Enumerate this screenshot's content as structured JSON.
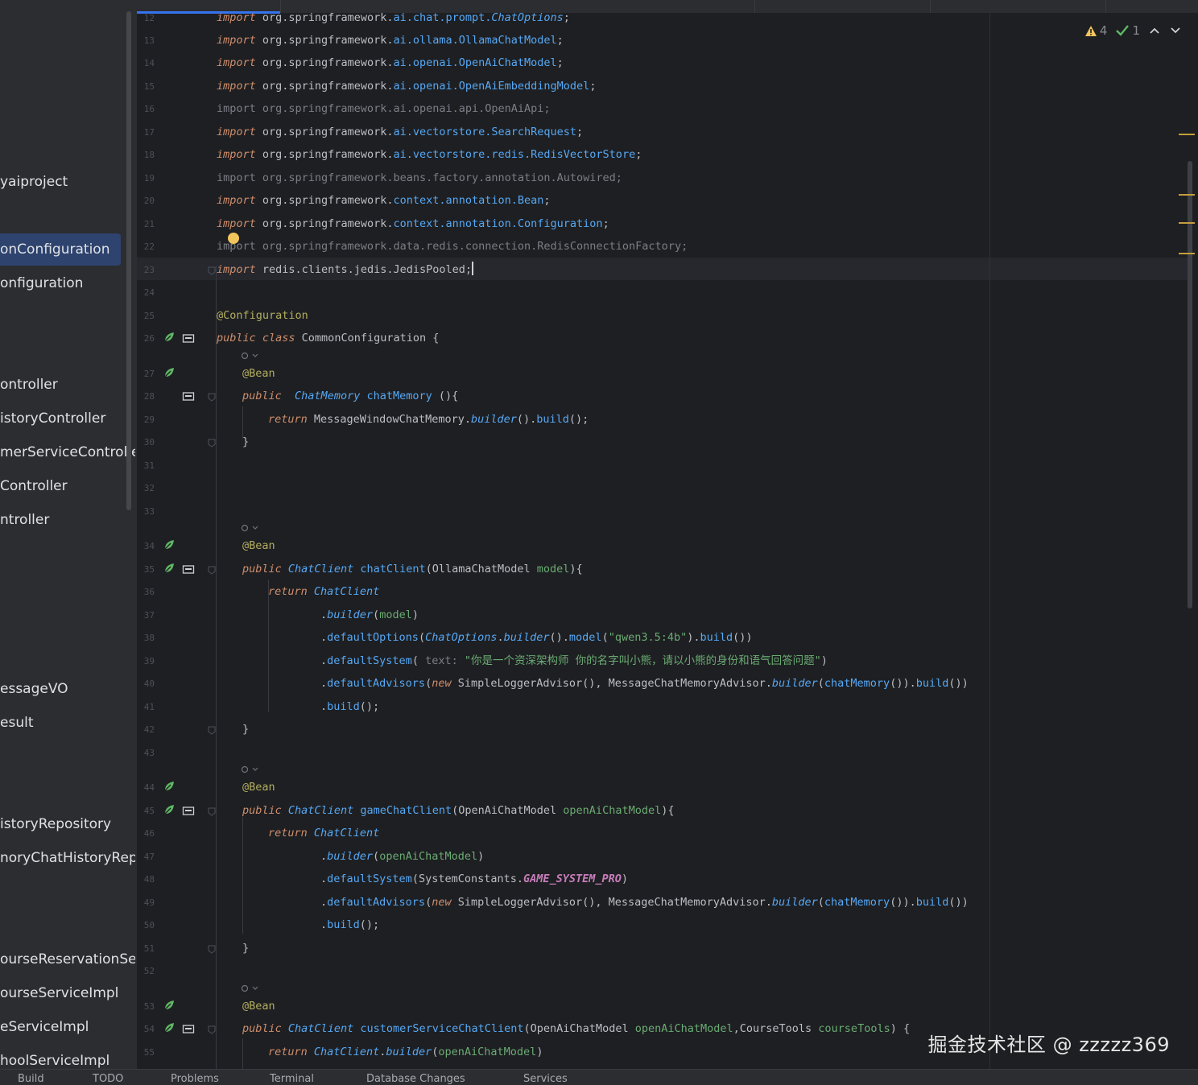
{
  "project_tree": {
    "items": [
      {
        "label": "yaiproject",
        "selected": false
      },
      {
        "label": "onConfiguration",
        "selected": true
      },
      {
        "label": "onfiguration",
        "selected": false
      },
      {
        "label": "ontroller",
        "selected": false
      },
      {
        "label": "istoryController",
        "selected": false
      },
      {
        "label": "merServiceController",
        "selected": false
      },
      {
        "label": "Controller",
        "selected": false
      },
      {
        "label": "ntroller",
        "selected": false
      },
      {
        "label": "essageVO",
        "selected": false
      },
      {
        "label": "esult",
        "selected": false
      },
      {
        "label": "istoryRepository",
        "selected": false
      },
      {
        "label": "noryChatHistoryRepos",
        "selected": false
      },
      {
        "label": "ourseReservationServ",
        "selected": false
      },
      {
        "label": "ourseServiceImpl",
        "selected": false
      },
      {
        "label": "eServiceImpl",
        "selected": false
      },
      {
        "label": "hoolServiceImpl",
        "selected": false
      }
    ]
  },
  "inspection": {
    "warnings": "4",
    "ok": "1"
  },
  "editor": {
    "line_numbers": [
      "12",
      "13",
      "14",
      "15",
      "16",
      "17",
      "18",
      "19",
      "20",
      "21",
      "22",
      "23",
      "24",
      "25",
      "26",
      "27",
      "28",
      "29",
      "30",
      "31",
      "32",
      "33",
      "34",
      "35",
      "36",
      "37",
      "38",
      "39",
      "40",
      "41",
      "42",
      "43",
      "44",
      "45",
      "46",
      "47",
      "48",
      "49",
      "50",
      "51",
      "52",
      "53",
      "54",
      "55"
    ],
    "lines": [
      {
        "ln": "12",
        "tokens": [
          [
            "kw",
            "import"
          ],
          [
            "cls",
            " org.springframework."
          ],
          [
            "fn",
            "ai.chat.prompt."
          ],
          [
            "iv",
            "ChatOptions"
          ],
          [
            "cls",
            ";"
          ]
        ]
      },
      {
        "ln": "13",
        "tokens": [
          [
            "kw",
            "import"
          ],
          [
            "cls",
            " org.springframework."
          ],
          [
            "fn",
            "ai.ollama.OllamaChatModel"
          ],
          [
            "cls",
            ";"
          ]
        ]
      },
      {
        "ln": "14",
        "tokens": [
          [
            "kw",
            "import"
          ],
          [
            "cls",
            " org.springframework."
          ],
          [
            "fn",
            "ai.openai.OpenAiChatModel"
          ],
          [
            "cls",
            ";"
          ]
        ]
      },
      {
        "ln": "15",
        "tokens": [
          [
            "kw",
            "import"
          ],
          [
            "cls",
            " org.springframework."
          ],
          [
            "fn",
            "ai.openai.OpenAiEmbeddingModel"
          ],
          [
            "cls",
            ";"
          ]
        ]
      },
      {
        "ln": "16",
        "tokens": [
          [
            "dim",
            "import org.springframework.ai.openai.api.OpenAiApi;"
          ]
        ]
      },
      {
        "ln": "17",
        "tokens": [
          [
            "kw",
            "import"
          ],
          [
            "cls",
            " org.springframework."
          ],
          [
            "fn",
            "ai.vectorstore.SearchRequest"
          ],
          [
            "cls",
            ";"
          ]
        ]
      },
      {
        "ln": "18",
        "tokens": [
          [
            "kw",
            "import"
          ],
          [
            "cls",
            " org.springframework."
          ],
          [
            "fn",
            "ai.vectorstore.redis.RedisVectorStore"
          ],
          [
            "cls",
            ";"
          ]
        ]
      },
      {
        "ln": "19",
        "tokens": [
          [
            "dim",
            "import org.springframework.beans.factory.annotation.Autowired;"
          ]
        ]
      },
      {
        "ln": "20",
        "tokens": [
          [
            "kw",
            "import"
          ],
          [
            "cls",
            " org.springframework."
          ],
          [
            "fn",
            "context.annotation.Bean"
          ],
          [
            "cls",
            ";"
          ]
        ]
      },
      {
        "ln": "21",
        "tokens": [
          [
            "kw",
            "import"
          ],
          [
            "cls",
            " org.springframework."
          ],
          [
            "fn",
            "context.annotation.Configuration"
          ],
          [
            "cls",
            ";"
          ]
        ]
      },
      {
        "ln": "22",
        "tokens": [
          [
            "dim",
            "import org.springframework.data.redis.connection.RedisConnectionFactory;"
          ]
        ]
      },
      {
        "ln": "23",
        "tokens": [
          [
            "kw",
            "import"
          ],
          [
            "cls",
            " redis.clients.jedis.JedisPooled;"
          ]
        ]
      },
      {
        "ln": "24",
        "tokens": []
      },
      {
        "ln": "25",
        "tokens": [
          [
            "ann",
            "@Configuration"
          ]
        ]
      },
      {
        "ln": "26",
        "tokens": [
          [
            "kw",
            "public class"
          ],
          [
            "cls",
            " CommonConfiguration {"
          ]
        ]
      },
      {
        "ln": "27",
        "tokens": [
          [
            "ann",
            "@Bean"
          ]
        ]
      },
      {
        "ln": "28",
        "tokens": [
          [
            "kw",
            "public"
          ],
          [
            "cls",
            "  "
          ],
          [
            "iv",
            "ChatMemory"
          ],
          [
            "fn",
            " chatMemory"
          ],
          [
            "cls",
            " (){"
          ]
        ]
      },
      {
        "ln": "29",
        "tokens": [
          [
            "kw",
            "return"
          ],
          [
            "cls",
            " MessageWindowChatMemory."
          ],
          [
            "iv",
            "builder"
          ],
          [
            "cls",
            "()."
          ],
          [
            "fn",
            "build"
          ],
          [
            "cls",
            "();"
          ]
        ]
      },
      {
        "ln": "30",
        "tokens": [
          [
            "cls",
            "}"
          ]
        ]
      },
      {
        "ln": "31",
        "tokens": []
      },
      {
        "ln": "32",
        "tokens": []
      },
      {
        "ln": "33",
        "tokens": []
      },
      {
        "ln": "34",
        "tokens": [
          [
            "ann",
            "@Bean"
          ]
        ]
      },
      {
        "ln": "35",
        "tokens": [
          [
            "kw",
            "public"
          ],
          [
            "cls",
            " "
          ],
          [
            "iv",
            "ChatClient"
          ],
          [
            "fn",
            " chatClient"
          ],
          [
            "cls",
            "(OllamaChatModel "
          ],
          [
            "st",
            "model"
          ],
          [
            "cls",
            "){"
          ]
        ]
      },
      {
        "ln": "36",
        "tokens": [
          [
            "kw",
            "return"
          ],
          [
            "cls",
            " "
          ],
          [
            "iv",
            "ChatClient"
          ]
        ]
      },
      {
        "ln": "37",
        "tokens": [
          [
            "cls",
            "."
          ],
          [
            "iv",
            "builder"
          ],
          [
            "cls",
            "("
          ],
          [
            "st",
            "model"
          ],
          [
            "cls",
            ")"
          ]
        ]
      },
      {
        "ln": "38",
        "tokens": [
          [
            "cls",
            "."
          ],
          [
            "fn",
            "defaultOptions"
          ],
          [
            "cls",
            "("
          ],
          [
            "iv",
            "ChatOptions"
          ],
          [
            "cls",
            "."
          ],
          [
            "iv",
            "builder"
          ],
          [
            "cls",
            "()."
          ],
          [
            "fn",
            "model"
          ],
          [
            "cls",
            "("
          ],
          [
            "st",
            "\"qwen3.5:4b\""
          ],
          [
            "cls",
            ")."
          ],
          [
            "fn",
            "build"
          ],
          [
            "cls",
            "())"
          ]
        ]
      },
      {
        "ln": "39",
        "tokens": [
          [
            "cls",
            "."
          ],
          [
            "fn",
            "defaultSystem"
          ],
          [
            "cls",
            "( "
          ],
          [
            "dim",
            "text:"
          ],
          [
            "st",
            " \"你是一个资深架构师 你的名字叫小熊，请以小熊的身份和语气回答问题\""
          ],
          [
            "cls",
            ")"
          ]
        ]
      },
      {
        "ln": "40",
        "tokens": [
          [
            "cls",
            "."
          ],
          [
            "fn",
            "defaultAdvisors"
          ],
          [
            "cls",
            "("
          ],
          [
            "kw",
            "new"
          ],
          [
            "cls",
            " SimpleLoggerAdvisor(), MessageChatMemoryAdvisor."
          ],
          [
            "iv",
            "builder"
          ],
          [
            "cls",
            "("
          ],
          [
            "fn",
            "chatMemory"
          ],
          [
            "cls",
            "())."
          ],
          [
            "fn",
            "build"
          ],
          [
            "cls",
            "())"
          ]
        ]
      },
      {
        "ln": "41",
        "tokens": [
          [
            "cls",
            "."
          ],
          [
            "fn",
            "build"
          ],
          [
            "cls",
            "();"
          ]
        ]
      },
      {
        "ln": "42",
        "tokens": [
          [
            "cls",
            "}"
          ]
        ]
      },
      {
        "ln": "43",
        "tokens": []
      },
      {
        "ln": "44",
        "tokens": [
          [
            "ann",
            "@Bean"
          ]
        ]
      },
      {
        "ln": "45",
        "tokens": [
          [
            "kw",
            "public"
          ],
          [
            "cls",
            " "
          ],
          [
            "iv",
            "ChatClient"
          ],
          [
            "fn",
            " gameChatClient"
          ],
          [
            "cls",
            "(OpenAiChatModel "
          ],
          [
            "st",
            "openAiChatModel"
          ],
          [
            "cls",
            "){"
          ]
        ]
      },
      {
        "ln": "46",
        "tokens": [
          [
            "kw",
            "return"
          ],
          [
            "cls",
            " "
          ],
          [
            "iv",
            "ChatClient"
          ]
        ]
      },
      {
        "ln": "47",
        "tokens": [
          [
            "cls",
            "."
          ],
          [
            "iv",
            "builder"
          ],
          [
            "cls",
            "("
          ],
          [
            "st",
            "openAiChatModel"
          ],
          [
            "cls",
            ")"
          ]
        ]
      },
      {
        "ln": "48",
        "tokens": [
          [
            "cls",
            "."
          ],
          [
            "fn",
            "defaultSystem"
          ],
          [
            "cls",
            "(SystemConstants."
          ],
          [
            "cn",
            "GAME_SYSTEM_PRO"
          ],
          [
            "cls",
            ")"
          ]
        ]
      },
      {
        "ln": "49",
        "tokens": [
          [
            "cls",
            "."
          ],
          [
            "fn",
            "defaultAdvisors"
          ],
          [
            "cls",
            "("
          ],
          [
            "kw",
            "new"
          ],
          [
            "cls",
            " SimpleLoggerAdvisor(), MessageChatMemoryAdvisor."
          ],
          [
            "iv",
            "builder"
          ],
          [
            "cls",
            "("
          ],
          [
            "fn",
            "chatMemory"
          ],
          [
            "cls",
            "())."
          ],
          [
            "fn",
            "build"
          ],
          [
            "cls",
            "())"
          ]
        ]
      },
      {
        "ln": "50",
        "tokens": [
          [
            "cls",
            "."
          ],
          [
            "fn",
            "build"
          ],
          [
            "cls",
            "();"
          ]
        ]
      },
      {
        "ln": "51",
        "tokens": [
          [
            "cls",
            "}"
          ]
        ]
      },
      {
        "ln": "52",
        "tokens": []
      },
      {
        "ln": "53",
        "tokens": [
          [
            "ann",
            "@Bean"
          ]
        ]
      },
      {
        "ln": "54",
        "tokens": [
          [
            "kw",
            "public"
          ],
          [
            "cls",
            " "
          ],
          [
            "iv",
            "ChatClient"
          ],
          [
            "fn",
            " customerServiceChatClient"
          ],
          [
            "cls",
            "(OpenAiChatModel "
          ],
          [
            "st",
            "openAiChatModel"
          ],
          [
            "cls",
            ",CourseTools "
          ],
          [
            "st",
            "courseTools"
          ],
          [
            "cls",
            ") {"
          ]
        ]
      },
      {
        "ln": "55",
        "tokens": [
          [
            "kw",
            "return"
          ],
          [
            "cls",
            " "
          ],
          [
            "iv",
            "ChatClient"
          ],
          [
            "cls",
            "."
          ],
          [
            "iv",
            "builder"
          ],
          [
            "cls",
            "("
          ],
          [
            "st",
            "openAiChatModel"
          ],
          [
            "cls",
            ")"
          ]
        ]
      }
    ]
  },
  "watermark": "掘金技术社区 @ zzzzz369",
  "bottom_tabs": [
    "Build",
    "TODO",
    "Problems",
    "Terminal",
    "Database Changes",
    "Services"
  ],
  "colors": {
    "bg": "#1e1f22",
    "keyword": "#cf8e6d",
    "annotation": "#b3ae60",
    "string": "#6aab73",
    "method": "#56a8f5",
    "selection": "#2e436e"
  },
  "icons": [
    "spring-bean-icon",
    "implementations-icon",
    "fold-icon",
    "warning-icon",
    "check-icon",
    "arrow-up-icon",
    "arrow-down-icon",
    "intention-bulb-icon"
  ]
}
